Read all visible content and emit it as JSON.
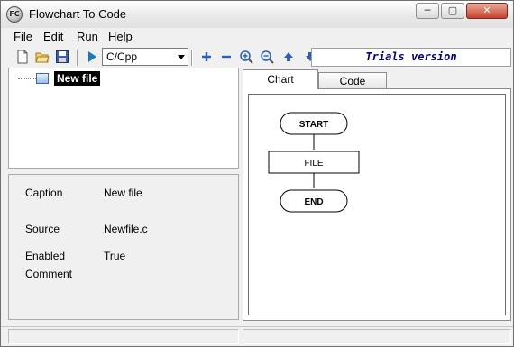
{
  "window": {
    "title": "Flowchart To Code",
    "app_icon_text": "FC"
  },
  "titlebar_buttons": {
    "minimize": "─",
    "maximize": "▢",
    "close": "✕"
  },
  "menu": [
    "File",
    "Edit",
    "Run",
    "Help"
  ],
  "toolbar": {
    "language": "C/Cpp",
    "trial_banner": "Trials version",
    "icons": [
      "new-file-icon",
      "open-folder-icon",
      "save-icon",
      "run-icon",
      "add-icon",
      "remove-icon",
      "zoom-in-icon",
      "zoom-out-icon",
      "move-up-icon",
      "move-down-icon"
    ]
  },
  "tree": {
    "root_label": "New file"
  },
  "properties": {
    "caption_label": "Caption",
    "caption_value": "New file",
    "source_label": "Source",
    "source_value": "Newfile.c",
    "enabled_label": "Enabled",
    "enabled_value": "True",
    "comment_label": "Comment"
  },
  "tabs": [
    "Chart",
    "Code"
  ],
  "flowchart": {
    "start_label": "START",
    "file_label": "FILE",
    "end_label": "END"
  },
  "colors": {
    "trial_text": "#000080",
    "selection_bg": "#000000",
    "toolbar_blue": "#2b5fb8",
    "run_green": "#1a7ab8"
  }
}
